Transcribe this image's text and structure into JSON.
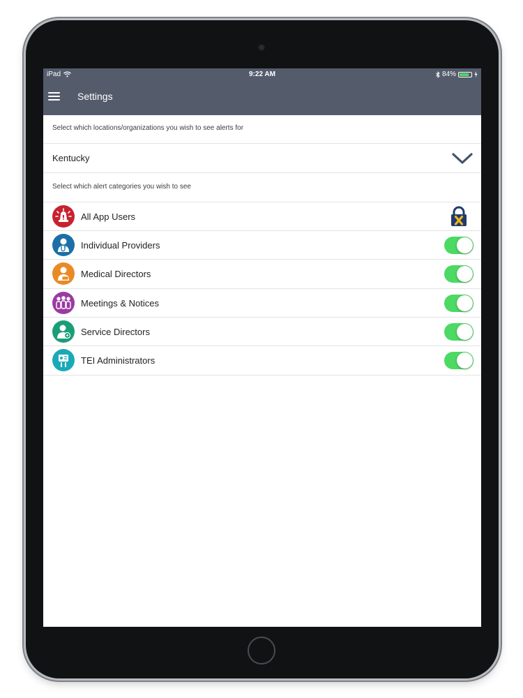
{
  "status_bar": {
    "carrier": "iPad",
    "time": "9:22 AM",
    "battery": "84%",
    "battery_level": 0.84
  },
  "header": {
    "title": "Settings"
  },
  "locations": {
    "hint": "Select which locations/organizations you wish to see alerts for",
    "selected": "Kentucky"
  },
  "categories": {
    "hint": "Select which alert categories you wish to see",
    "items": [
      {
        "label": "All App Users",
        "icon": "alert-siren-icon",
        "color": "#c8222f",
        "control": "lock"
      },
      {
        "label": "Individual Providers",
        "icon": "provider-person-icon",
        "color": "#1b6fa7",
        "control": "toggle",
        "enabled": true
      },
      {
        "label": "Medical Directors",
        "icon": "director-person-icon",
        "color": "#ea8a25",
        "control": "toggle",
        "enabled": true
      },
      {
        "label": "Meetings & Notices",
        "icon": "group-people-icon",
        "color": "#9b3aa3",
        "control": "toggle",
        "enabled": true
      },
      {
        "label": "Service Directors",
        "icon": "service-person-icon",
        "color": "#1a9e78",
        "control": "toggle",
        "enabled": true
      },
      {
        "label": "TEI Administrators",
        "icon": "admin-person-icon",
        "color": "#1aa9b7",
        "control": "toggle",
        "enabled": true
      }
    ]
  },
  "colors": {
    "header_bg": "#545c6c",
    "toggle_on": "#4cd964",
    "chevron": "#45506a",
    "lock_body": "#1f3b6e",
    "lock_mark": "#f0b41c"
  }
}
